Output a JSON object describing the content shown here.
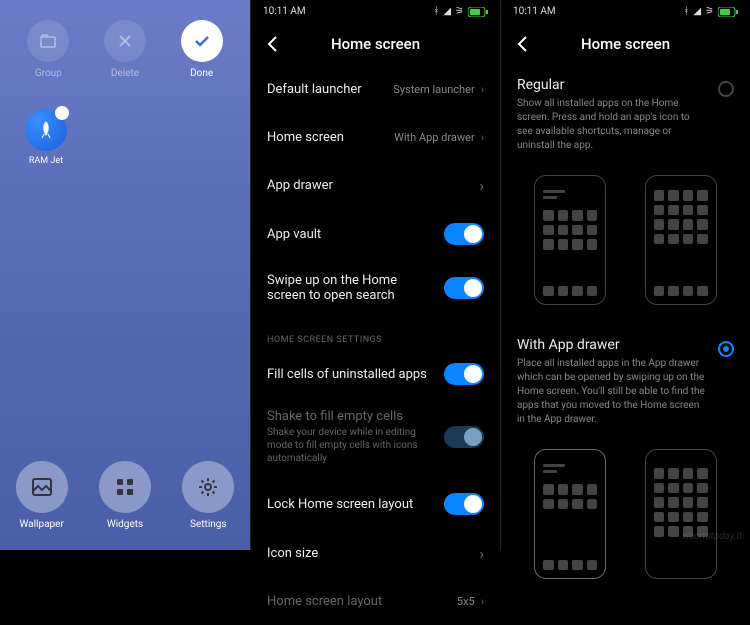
{
  "screen1": {
    "topActions": [
      {
        "name": "group",
        "label": "Group",
        "icon": "folder",
        "active": false
      },
      {
        "name": "delete",
        "label": "Delete",
        "icon": "x",
        "active": false
      },
      {
        "name": "done",
        "label": "Done",
        "icon": "check",
        "active": true
      }
    ],
    "app": {
      "label": "RAM Jet"
    },
    "bottomActions": [
      {
        "name": "wallpaper",
        "label": "Wallpaper",
        "icon": "image"
      },
      {
        "name": "widgets",
        "label": "Widgets",
        "icon": "grid"
      },
      {
        "name": "settings",
        "label": "Settings",
        "icon": "gear"
      }
    ]
  },
  "screen2": {
    "time": "10:11 AM",
    "title": "Home screen",
    "rows": {
      "default_launcher": {
        "label": "Default launcher",
        "value": "System launcher"
      },
      "home_screen": {
        "label": "Home screen",
        "value": "With App drawer"
      },
      "app_drawer": {
        "label": "App drawer"
      },
      "app_vault": {
        "label": "App vault"
      },
      "swipe_search": {
        "label": "Swipe up on the Home screen to open search"
      },
      "fill_cells": {
        "label": "Fill cells of uninstalled apps"
      },
      "shake": {
        "label": "Shake to fill empty cells",
        "sub": "Shake your device while in editing mode to fill empty cells with icons automatically"
      },
      "lock_layout": {
        "label": "Lock Home screen layout"
      },
      "icon_size": {
        "label": "Icon size"
      },
      "layout": {
        "label": "Home screen layout",
        "value": "5x5"
      }
    },
    "section": "HOME SCREEN SETTINGS"
  },
  "screen3": {
    "time": "10:11 AM",
    "title": "Home screen",
    "option1": {
      "title": "Regular",
      "desc": "Show all installed apps on the Home screen. Press and hold an app's icon to see available shortcuts, manage or uninstall the app."
    },
    "option2": {
      "title": "With App drawer",
      "desc": "Place all installed apps in the App drawer which can be opened by swiping up on the Home screen. You'll still be able to find the apps that you moved to the Home screen in the App drawer."
    }
  },
  "watermark": "xiaomitoday.it"
}
